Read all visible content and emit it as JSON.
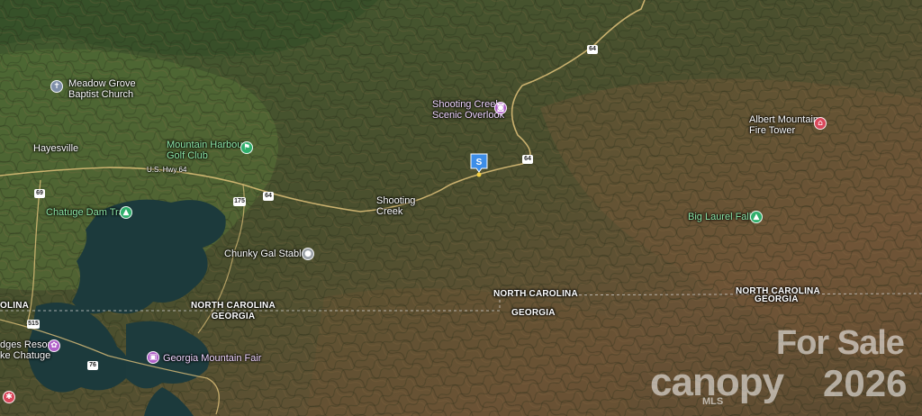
{
  "map": {
    "type": "satellite",
    "places": {
      "meadow_grove": "Meadow Grove\nBaptist Church",
      "hayesville": "Hayesville",
      "mountain_harbour": "Mountain Harbour\nGolf Club",
      "shooting_creek_overlook": "Shooting Creek\nScenic Overlook",
      "albert_mountain": "Albert Mountain\nFire Tower",
      "chatuge_dam": "Chatuge Dam Trail",
      "shooting_creek": "Shooting\nCreek",
      "big_laurel": "Big Laurel Falls",
      "chunky_gal": "Chunky Gal Stables",
      "georgia_fair": "Georgia Mountain Fair",
      "ridges_resort": "dges Resort\nke Chatuge",
      "us_hwy": "U.S. Hwy 64"
    },
    "borders": {
      "nc_mid": "NORTH CAROLINA",
      "ga_mid": "GEORGIA",
      "nc_right": "NORTH CAROLINA",
      "ga_right": "GEORGIA",
      "nc_left": "NORTH CAROLINA\nGEORGIA",
      "nc_far_left": "OLINA"
    },
    "shields": [
      "64",
      "64",
      "64",
      "69",
      "175",
      "515",
      "76"
    ],
    "marker_label": "S"
  },
  "watermark": {
    "for_sale": "For Sale",
    "brand": "canopy",
    "mls": "MLS",
    "year": "2026"
  },
  "colors": {
    "marker": "#3d8ee8",
    "park": "#2fae6b",
    "attraction": "#b060c8",
    "landmark": "#d9475a"
  }
}
